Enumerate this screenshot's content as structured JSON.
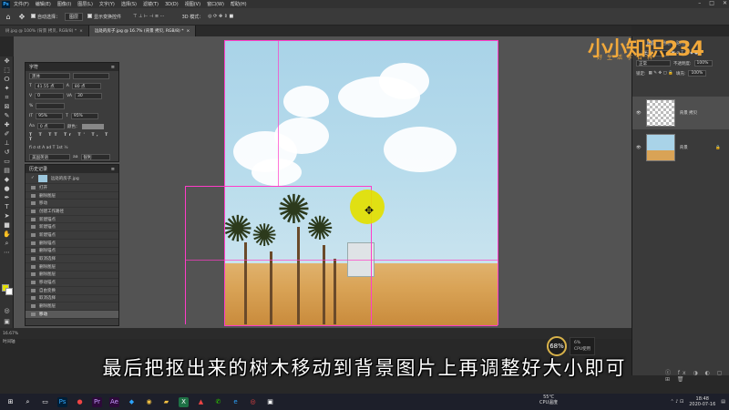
{
  "menu": {
    "items": [
      "文件(F)",
      "编辑(E)",
      "图像(I)",
      "图层(L)",
      "文字(Y)",
      "选择(S)",
      "滤镜(T)",
      "3D(D)",
      "视图(V)",
      "窗口(W)",
      "帮助(H)"
    ],
    "app_icon": "Ps"
  },
  "options": {
    "auto_select_label": "自动选择：",
    "auto_select_target": "图层",
    "show_transform_label": "显示变换控件",
    "mode_3d_label": "3D 模式："
  },
  "tabs": [
    {
      "label": "树.jpg @ 100% (背景 拷贝, RGB/8) *",
      "active": false
    },
    {
      "label": "远处的房子.jpg @ 16.7% (背景 拷贝, RGB/8) *",
      "active": true
    }
  ],
  "character_panel": {
    "title": "字符",
    "font": "黑体",
    "size": "41.55 点",
    "leading": "80 点",
    "tracking": "0",
    "kerning": "30",
    "vscale": "95%",
    "hscale": "95%",
    "baseline": "0 点",
    "color_label": "颜色：",
    "lang": "美国英语",
    "aa": "锐利"
  },
  "history_panel": {
    "title": "历史记录",
    "snapshot": "远处的房子.jpg",
    "items": [
      "打开",
      "删除图层",
      "移动",
      "创建工作路径",
      "新建锚点",
      "新建锚点",
      "新建锚点",
      "删除锚点",
      "删除锚点",
      "取消选择",
      "删除图层",
      "删除图层",
      "移动锚点",
      "自由变换",
      "取消选择",
      "删除图层",
      "移动"
    ]
  },
  "right_panel": {
    "tabs": [
      "图层",
      "通道",
      "路径"
    ],
    "kind_label": "类型",
    "blend_mode": "正常",
    "opacity_label": "不透明度:",
    "opacity_value": "100%",
    "lock_label": "锁定:",
    "fill_label": "填充:",
    "fill_value": "100%",
    "layers": [
      {
        "name": "背景 拷贝",
        "selected": true
      },
      {
        "name": "背景",
        "selected": false
      }
    ]
  },
  "status": {
    "zoom": "16.67%",
    "label": "时间轴"
  },
  "subtitle": "最后把抠出来的树木移动到背景图片上再调整好大小即可",
  "cpu": {
    "percent": "68%",
    "usage": "6%",
    "usage_label": "CPU使用",
    "temp": "55℃",
    "temp_label": "CPU温度"
  },
  "tray": {
    "time": "18:48",
    "date": "2020-07-16"
  },
  "watermark": {
    "logo": "小小知识234",
    "sub": "好生活字百科"
  },
  "colors": {
    "accent": "#31a8ff",
    "guide": "#ff3cc8",
    "highlight": "#e3e000"
  }
}
